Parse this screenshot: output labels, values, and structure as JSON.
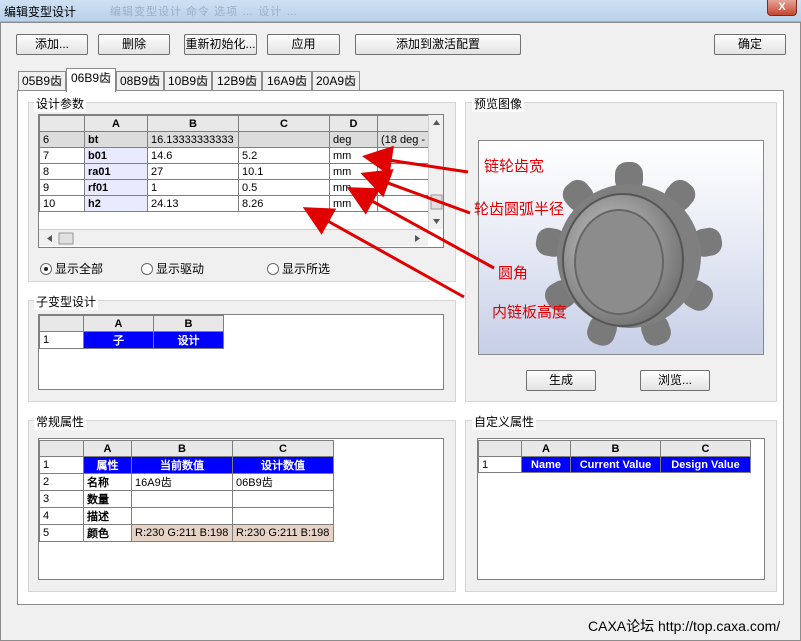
{
  "window": {
    "title": "编辑变型设计",
    "ghost_text": "编辑变型设计  命令  选项  …  设计  …",
    "close": "X"
  },
  "toolbar": {
    "add": "添加...",
    "delete": "删除",
    "reinit": "重新初始化...",
    "apply": "应用",
    "add_active": "添加到激活配置",
    "ok": "确定"
  },
  "tabs": [
    "05B9齿",
    "06B9齿",
    "08B9齿",
    "10B9齿",
    "12B9齿",
    "16A9齿",
    "20A9齿"
  ],
  "design_params": {
    "title": "设计参数",
    "columns": [
      "A",
      "B",
      "C",
      "D",
      ""
    ],
    "rows": [
      {
        "num": "6",
        "a": "bt",
        "b": "16.13333333333",
        "c": "",
        "d": "deg",
        "e": "(18 deg -"
      },
      {
        "num": "7",
        "a": "b01",
        "b": "14.6",
        "c": "5.2",
        "d": "mm",
        "e": ""
      },
      {
        "num": "8",
        "a": "ra01",
        "b": "27",
        "c": "10.1",
        "d": "mm",
        "e": ""
      },
      {
        "num": "9",
        "a": "rf01",
        "b": "1",
        "c": "0.5",
        "d": "mm",
        "e": ""
      },
      {
        "num": "10",
        "a": "h2",
        "b": "24.13",
        "c": "8.26",
        "d": "mm",
        "e": ""
      }
    ],
    "radio_all": "显示全部",
    "radio_driving": "显示驱动",
    "radio_selected": "显示所选"
  },
  "preview": {
    "title": "预览图像",
    "generate": "生成",
    "browse": "浏览..."
  },
  "annotations": {
    "tooth_width": "链轮齿宽",
    "tooth_arc_radius": "轮齿圆弧半径",
    "fillet": "圆角",
    "inner_plate_height": "内链板高度"
  },
  "sub_design": {
    "title": "子变型设计",
    "columns": [
      "A",
      "B"
    ],
    "row": {
      "num": "1",
      "a": "子",
      "b": "设计"
    }
  },
  "general_props": {
    "title": "常规属性",
    "columns": [
      "A",
      "B",
      "C"
    ],
    "rows": [
      {
        "num": "1",
        "a": "属性",
        "b": "当前数值",
        "c": "设计数值"
      },
      {
        "num": "2",
        "a": "名称",
        "b": "16A9齿",
        "c": "06B9齿"
      },
      {
        "num": "3",
        "a": "数量",
        "b": "",
        "c": ""
      },
      {
        "num": "4",
        "a": "描述",
        "b": "",
        "c": ""
      },
      {
        "num": "5",
        "a": "颜色",
        "b": "R:230 G:211 B:198",
        "c": "R:230 G:211 B:198"
      }
    ]
  },
  "custom_props": {
    "title": "自定义属性",
    "columns": [
      "A",
      "B",
      "C"
    ],
    "row": {
      "num": "1",
      "a": "Name",
      "b": "Current Value",
      "c": "Design Value"
    }
  },
  "footer": "CAXA论坛 http://top.caxa.com/",
  "colors": {
    "accent_blue": "#0000ff",
    "annotation_red": "#e00000",
    "swatch": "#e6d3c6"
  }
}
